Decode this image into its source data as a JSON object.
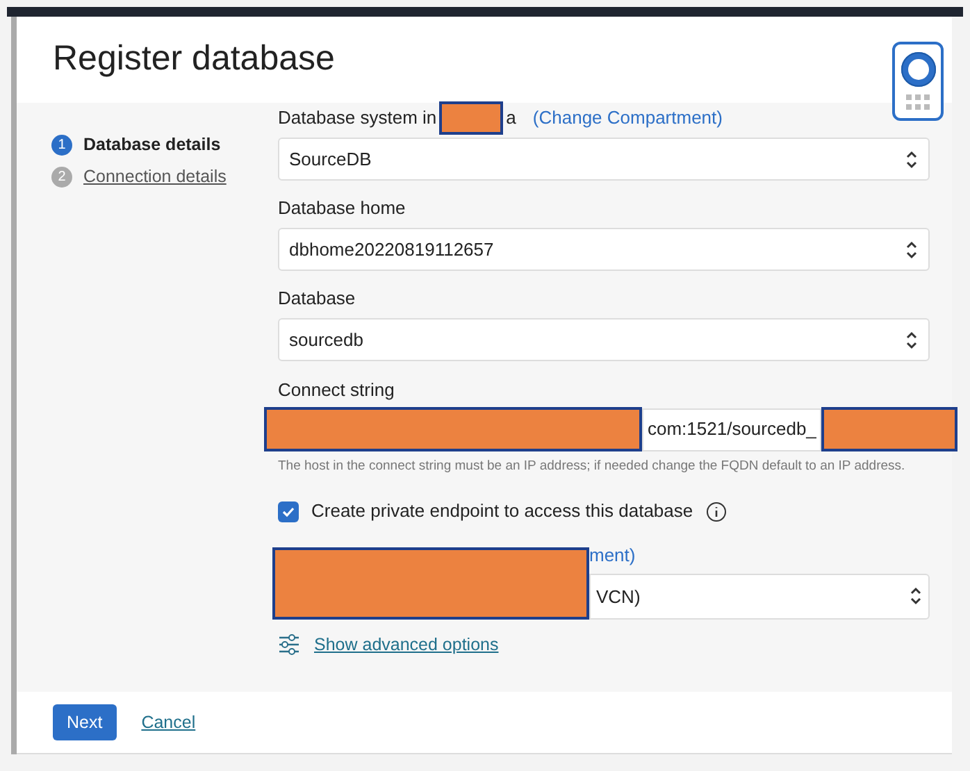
{
  "dialog": {
    "title": "Register database"
  },
  "steps": [
    {
      "number": "1",
      "label": "Database details",
      "selected": true
    },
    {
      "number": "2",
      "label": "Connection details",
      "selected": false
    }
  ],
  "fields": [
    {
      "kind": "select",
      "label": "Database system in",
      "label_tail": "a",
      "link": "(Change Compartment)",
      "value": "SourceDB"
    },
    {
      "kind": "select",
      "label": "Database home",
      "value": "dbhome20220819112657"
    },
    {
      "kind": "select",
      "label": "Database",
      "value": "sourcedb"
    },
    {
      "kind": "text",
      "label": "Connect string",
      "value": "com:1521/sourcedb_",
      "help": "The host in the connect string must be an IP address; if needed change the FQDN default to an IP address."
    },
    {
      "kind": "checkbox",
      "label": "Create private endpoint to access this database",
      "checked": true
    },
    {
      "kind": "redacted_select",
      "link": "ment)",
      "value": "VCN)"
    }
  ],
  "advanced_link": "Show advanced options",
  "buttons": {
    "primary": "Next",
    "secondary": "Cancel"
  }
}
